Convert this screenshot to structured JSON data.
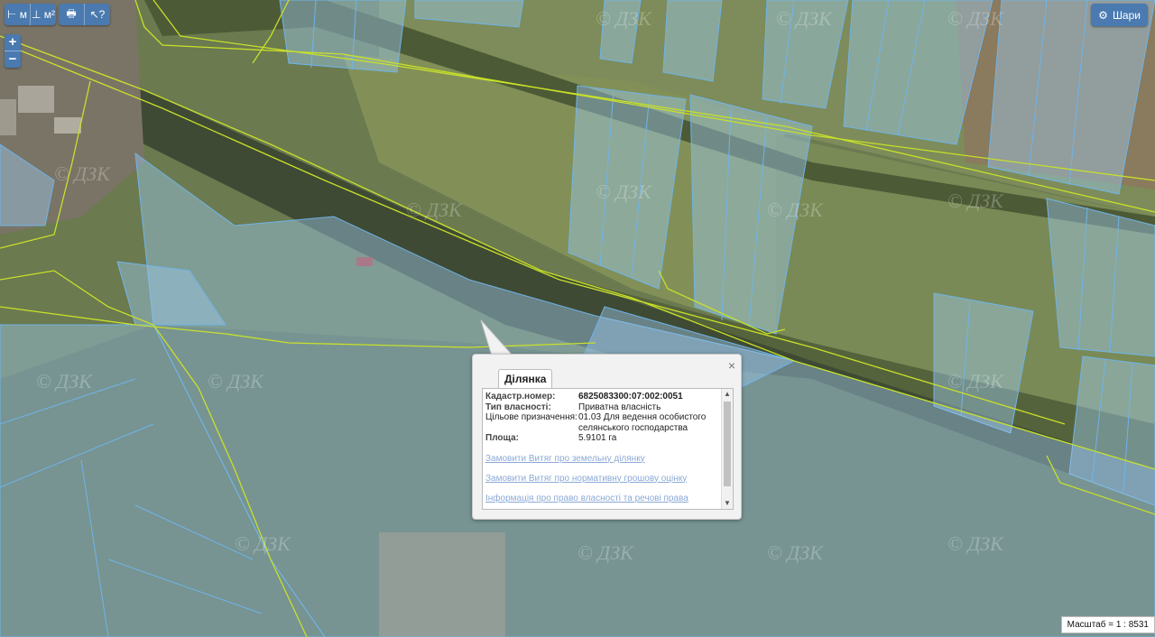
{
  "toolbar": {
    "buttons": [
      {
        "name": "measure-length-button",
        "label": "⊢ м",
        "icon": "measure-length-icon"
      },
      {
        "name": "measure-area-button",
        "label": "⊥ м²",
        "icon": "measure-area-icon"
      },
      {
        "name": "print-button",
        "label": "🖶",
        "icon": "print-icon"
      },
      {
        "name": "identify-button",
        "label": "↖?",
        "icon": "identify-icon"
      }
    ]
  },
  "zoom": {
    "in_label": "+",
    "out_label": "−"
  },
  "layers_button": {
    "icon": "gear-icon",
    "label": "Шари"
  },
  "scale_text": "Масштаб = 1 : 8531",
  "popup": {
    "tab": "Ділянка",
    "close": "×",
    "rows": [
      {
        "key": "Кадастр.номер:",
        "value": "6825083300:07:002:0051"
      },
      {
        "key": "Тип власності:",
        "value": "Приватна власність"
      },
      {
        "key": "Цільове призначення:",
        "value": "01.03 Для ведення особистого селянського господарства"
      },
      {
        "key": "Площа:",
        "value": "5.9101 га"
      }
    ],
    "links": [
      "Замовити Витяг про земельну ділянку",
      "Замовити Витяг про нормативну грошову оцінку",
      "Інформація про право власності та речові права"
    ],
    "scroll_up": "▲",
    "scroll_down": "▼"
  },
  "colors": {
    "parcel_stroke": "#6fb4e8",
    "parcel_fill": "#9cc7ea",
    "boundary": "#c8e02a",
    "toolbar": "#4a7ab0"
  }
}
